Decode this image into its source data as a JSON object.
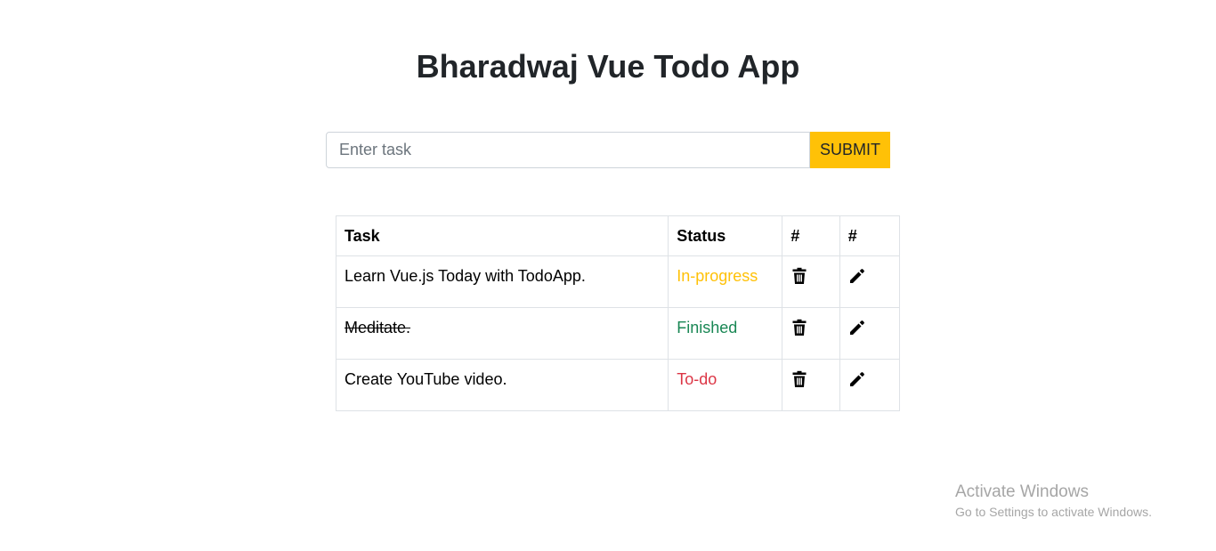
{
  "header": {
    "title": "Bharadwaj Vue Todo App"
  },
  "form": {
    "placeholder": "Enter task",
    "value": "",
    "submit_label": "SUBMIT"
  },
  "table": {
    "headers": {
      "task": "Task",
      "status": "Status",
      "delete": "#",
      "edit": "#"
    },
    "rows": [
      {
        "task": "Learn Vue.js Today with TodoApp.",
        "status": "In-progress",
        "status_color": "#ffc107",
        "finished": false,
        "delete_icon": "trash-icon",
        "edit_icon": "pencil-icon"
      },
      {
        "task": "Meditate.",
        "status": "Finished",
        "status_color": "#198754",
        "finished": true,
        "delete_icon": "trash-icon",
        "edit_icon": "pencil-icon"
      },
      {
        "task": "Create YouTube video.",
        "status": "To-do",
        "status_color": "#dc3545",
        "finished": false,
        "delete_icon": "trash-icon",
        "edit_icon": "pencil-icon"
      }
    ]
  },
  "watermark": {
    "title": "Activate Windows",
    "subtitle": "Go to Settings to activate Windows."
  },
  "colors": {
    "accent": "#ffc107",
    "in_progress": "#ffc107",
    "finished": "#198754",
    "todo": "#dc3545"
  }
}
